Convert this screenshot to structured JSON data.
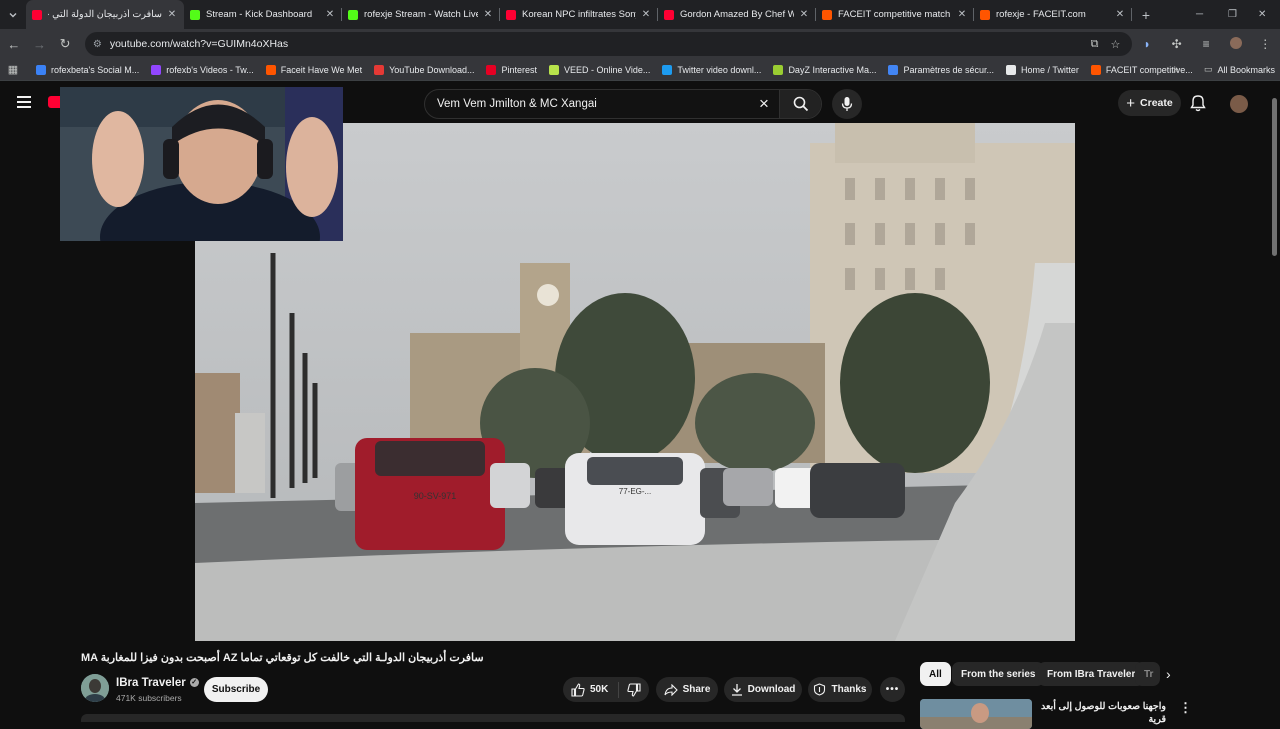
{
  "browser": {
    "tabs": [
      {
        "title": "سافرت أذربيجان الدولة التي خالفت",
        "color": "#ff0033",
        "active": true
      },
      {
        "title": "Stream - Kick Dashboard",
        "color": "#53fc18",
        "active": false
      },
      {
        "title": "rofexje Stream - Watch Live on",
        "color": "#53fc18",
        "active": false
      },
      {
        "title": "Korean NPC infiltrates Sony HQ",
        "color": "#ff0033",
        "active": false
      },
      {
        "title": "Gordon Amazed By Chef Who",
        "color": "#ff0033",
        "active": false
      },
      {
        "title": "FACEIT competitive match - FA",
        "color": "#ff5500",
        "active": false
      },
      {
        "title": "rofexje - FACEIT.com",
        "color": "#ff5500",
        "active": false
      }
    ],
    "url": "youtube.com/watch?v=GUIMn4oXHas",
    "bookmarks": [
      {
        "label": "rofexbeta's Social M...",
        "color": "#3b82f6"
      },
      {
        "label": "rofexb's Videos - Tw...",
        "color": "#9146ff"
      },
      {
        "label": "Faceit Have We Met",
        "color": "#ff5500"
      },
      {
        "label": "YouTube Download...",
        "color": "#e53935"
      },
      {
        "label": "Pinterest",
        "color": "#e60023"
      },
      {
        "label": "VEED - Online Vide...",
        "color": "#b8e34b"
      },
      {
        "label": "Twitter video downl...",
        "color": "#1d9bf0"
      },
      {
        "label": "DayZ Interactive Ma...",
        "color": "#9acd32"
      },
      {
        "label": "Paramètres de sécur...",
        "color": "#4285f4"
      },
      {
        "label": "Home / Twitter",
        "color": "#e7e9ea"
      },
      {
        "label": "FACEIT competitive...",
        "color": "#ff5500"
      }
    ],
    "all_bookmarks": "All Bookmarks"
  },
  "youtube": {
    "search_query": "Vem Vem Jmilton & MC Xangai",
    "create_label": "Create",
    "video_title": "MA أصبحت بدون فيزا للمغاربة AZ سافرت أذربيجان الدولـة التي خالفت كل توقعاتي تماما",
    "channel_name": "IBra Traveler",
    "subscribers": "471K subscribers",
    "subscribe_label": "Subscribe",
    "likes": "50K",
    "share_label": "Share",
    "download_label": "Download",
    "thanks_label": "Thanks",
    "chips": [
      "All",
      "From the series",
      "From IBra Traveler",
      "Tr"
    ],
    "rec_title": "واجهنا صعوبات للوصول إلى أبعد قرية",
    "player_text": {
      "clock_tower_plate": "90-SV-971",
      "car_plate": "77-EG-..."
    }
  },
  "colors": {
    "accent": "#ff0033",
    "bg": "#0f0f0f"
  }
}
